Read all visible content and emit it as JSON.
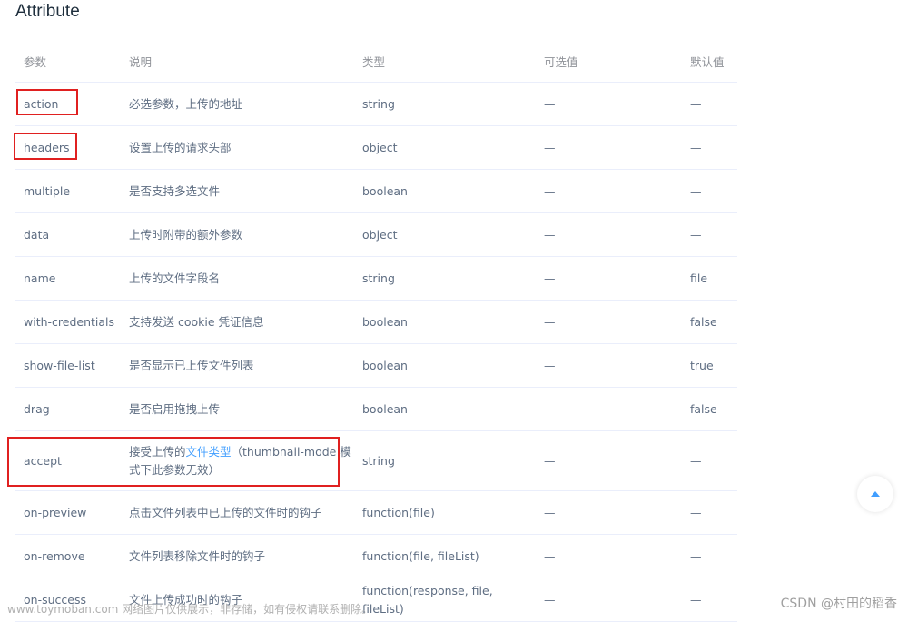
{
  "section_title": "Attribute",
  "table": {
    "headers": [
      "参数",
      "说明",
      "类型",
      "可选值",
      "默认值"
    ],
    "rows": [
      {
        "param": "action",
        "desc": "必选参数，上传的地址",
        "type": "string",
        "options": "—",
        "default": "—"
      },
      {
        "param": "headers",
        "desc": "设置上传的请求头部",
        "type": "object",
        "options": "—",
        "default": "—"
      },
      {
        "param": "multiple",
        "desc": "是否支持多选文件",
        "type": "boolean",
        "options": "—",
        "default": "—"
      },
      {
        "param": "data",
        "desc": "上传时附带的额外参数",
        "type": "object",
        "options": "—",
        "default": "—"
      },
      {
        "param": "name",
        "desc": "上传的文件字段名",
        "type": "string",
        "options": "—",
        "default": "file"
      },
      {
        "param": "with-credentials",
        "desc": "支持发送 cookie 凭证信息",
        "type": "boolean",
        "options": "—",
        "default": "false"
      },
      {
        "param": "show-file-list",
        "desc": "是否显示已上传文件列表",
        "type": "boolean",
        "options": "—",
        "default": "true"
      },
      {
        "param": "drag",
        "desc": "是否启用拖拽上传",
        "type": "boolean",
        "options": "—",
        "default": "false"
      },
      {
        "param": "accept",
        "desc_pre": "接受上传的",
        "desc_link": "文件类型",
        "desc_post": "（thumbnail-mode 模式下此参数无效）",
        "type": "string",
        "options": "—",
        "default": "—"
      },
      {
        "param": "on-preview",
        "desc": "点击文件列表中已上传的文件时的钩子",
        "type": "function(file)",
        "options": "—",
        "default": "—"
      },
      {
        "param": "on-remove",
        "desc": "文件列表移除文件时的钩子",
        "type": "function(file, fileList)",
        "options": "—",
        "default": "—"
      },
      {
        "param": "on-success",
        "desc": "文件上传成功时的钩子",
        "type": "function(response, file, fileList)",
        "options": "—",
        "default": "—"
      }
    ]
  },
  "back_to_top_icon": "caret-up-icon",
  "highlight_color": "#e02020",
  "link_color": "#409eff",
  "watermark_left": "www.toymoban.com 网络图片仅供展示，非存储，如有侵权请联系删除。",
  "watermark_right": "CSDN @村田的稻香"
}
